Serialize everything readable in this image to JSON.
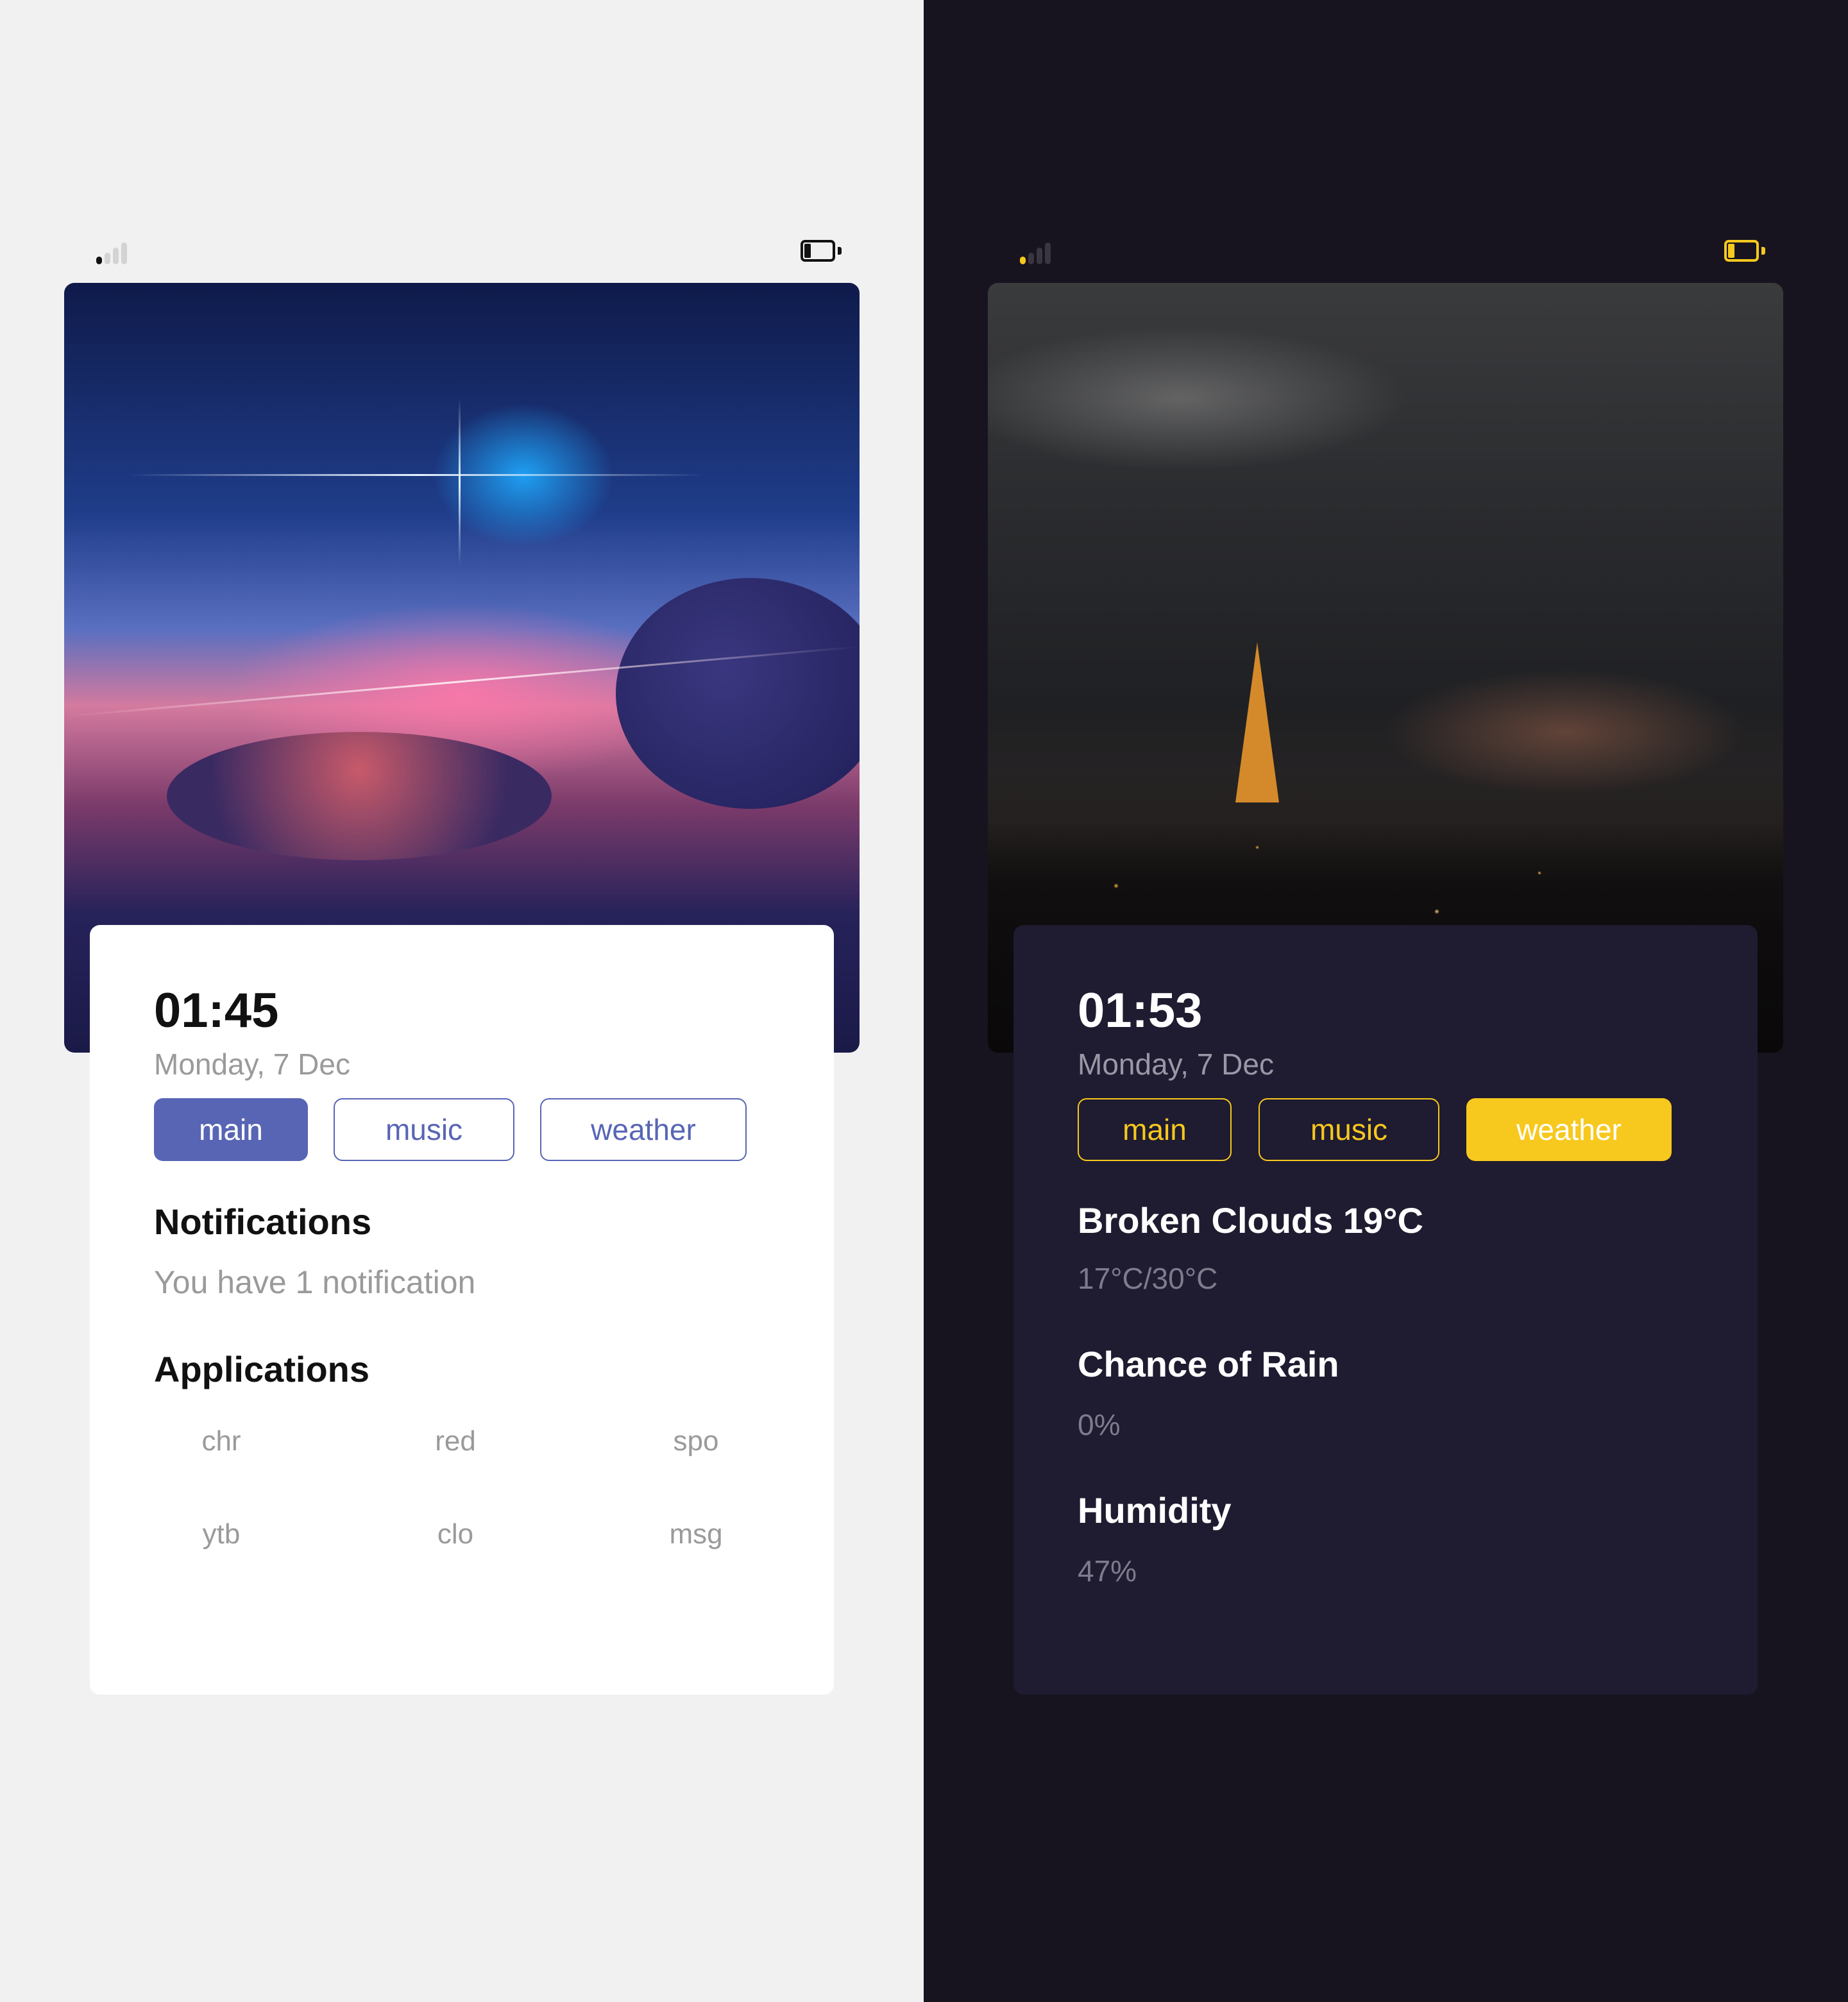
{
  "light": {
    "accent": "#5865b5",
    "clock": {
      "time": "01:45",
      "date": "Monday, 7 Dec"
    },
    "tabs": [
      {
        "label": "main",
        "active": true
      },
      {
        "label": "music",
        "active": false
      },
      {
        "label": "weather",
        "active": false
      }
    ],
    "notifications": {
      "title": "Notifications",
      "text": "You have 1 notification"
    },
    "applications": {
      "title": "Applications",
      "items": [
        "chr",
        "red",
        "spo",
        "ytb",
        "clo",
        "msg"
      ]
    }
  },
  "dark": {
    "accent": "#f7c81e",
    "clock": {
      "time": "01:53",
      "date": "Monday, 7 Dec"
    },
    "tabs": [
      {
        "label": "main",
        "active": false
      },
      {
        "label": "music",
        "active": false
      },
      {
        "label": "weather",
        "active": true
      }
    ],
    "weather": {
      "condition": "Broken Clouds 19°C",
      "range": "17°C/30°C",
      "rain_title": "Chance of Rain",
      "rain_value": "0%",
      "humidity_title": "Humidity",
      "humidity_value": "47%"
    }
  },
  "icons": [
    "signal-icon",
    "battery-icon"
  ]
}
